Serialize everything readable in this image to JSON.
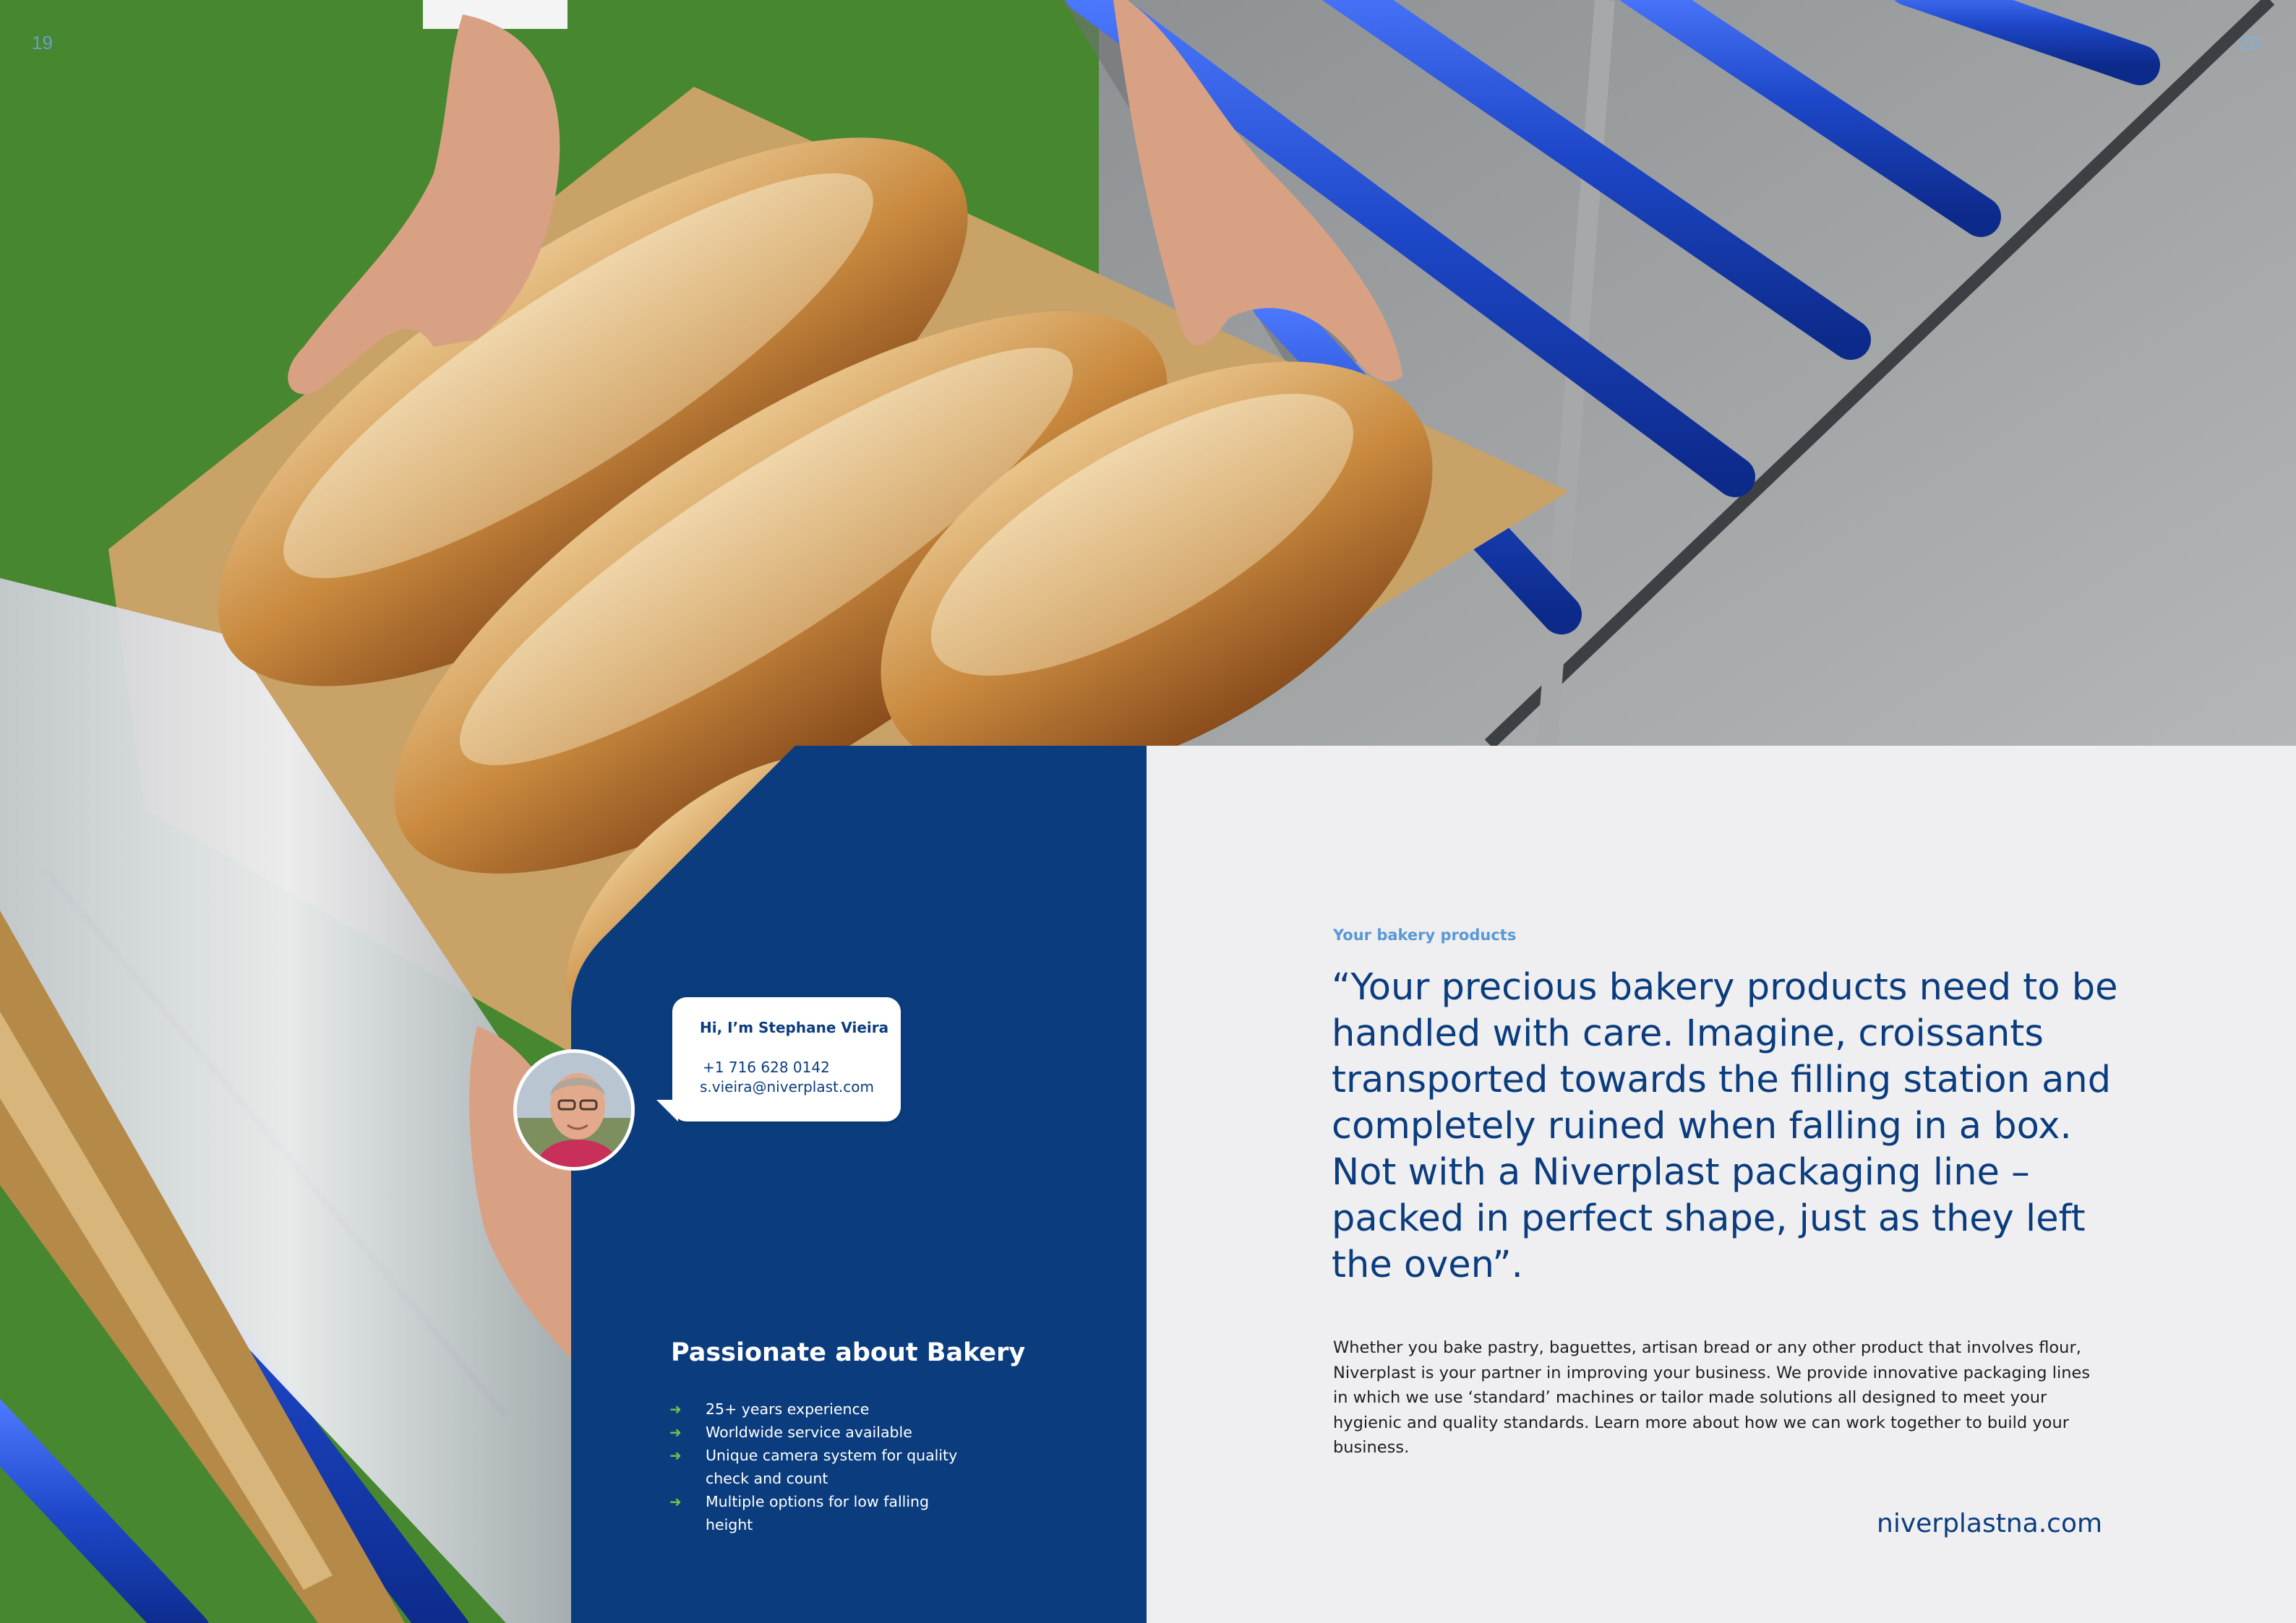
{
  "pages": {
    "left": "19",
    "right": "20"
  },
  "colors": {
    "navy": "#0b3d7e",
    "panel_gray": "#efeff1",
    "conveyor_blue": "#1d47c8",
    "accent_green": "#6cc24a",
    "kicker_blue": "#5a98d6"
  },
  "contact": {
    "greeting": "Hi, I’m Stephane Vieira",
    "phone": "+1 716 628 0142",
    "email": "s.vieira@niverplast.com"
  },
  "feature_box": {
    "title": "Passionate about Bakery",
    "bullet_icon": "arrow-right-icon",
    "bullets": [
      "25+ years experience",
      "Worldwide service available",
      "Unique camera system for quality check and count",
      "Multiple options for low falling height"
    ]
  },
  "main": {
    "kicker": "Your bakery products",
    "quote": "“Your precious bakery products need to be handled with care. Imagine, croissants transported towards the filling station and completely ruined when falling in a box. Not with a Niverplast packaging line – packed in perfect shape, just as they left the oven”.",
    "body": "Whether you bake pastry, baguettes, artisan bread or any other product that involves flour, Niverplast is your partner in improving your business. We provide innovative packaging lines in which we use ‘standard’ machines or tailor made solutions all designed to meet your hygienic and quality standards. Learn more about how we can work together to build your business.",
    "website": "niverplastna.com"
  }
}
